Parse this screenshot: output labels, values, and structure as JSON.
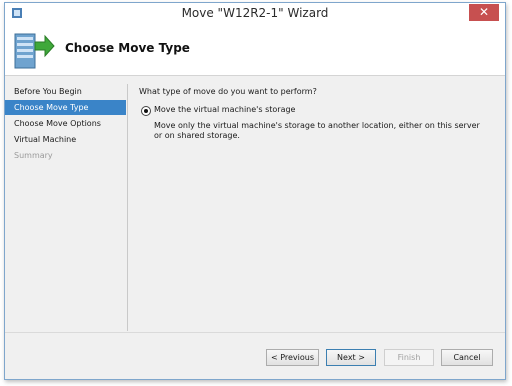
{
  "window": {
    "title": "Move \"W12R2-1\" Wizard",
    "close_glyph": "✕"
  },
  "header": {
    "title": "Choose Move Type",
    "icon": "server-with-green-arrow-icon"
  },
  "sidebar": {
    "items": [
      {
        "label": "Before You Begin",
        "state": "normal"
      },
      {
        "label": "Choose Move Type",
        "state": "active"
      },
      {
        "label": "Choose Move Options",
        "state": "normal"
      },
      {
        "label": "Virtual Machine",
        "state": "normal"
      },
      {
        "label": "Summary",
        "state": "disabled"
      }
    ]
  },
  "main": {
    "question": "What type of move do you want to perform?",
    "option": {
      "label": "Move the virtual machine's storage",
      "selected": true,
      "description": "Move only the virtual machine's storage to another location, either on this server or on shared storage."
    }
  },
  "buttons": {
    "previous": "< Previous",
    "next": "Next >",
    "finish": "Finish",
    "cancel": "Cancel"
  },
  "colors": {
    "accent": "#3a84c8",
    "close_button": "#c75050"
  }
}
